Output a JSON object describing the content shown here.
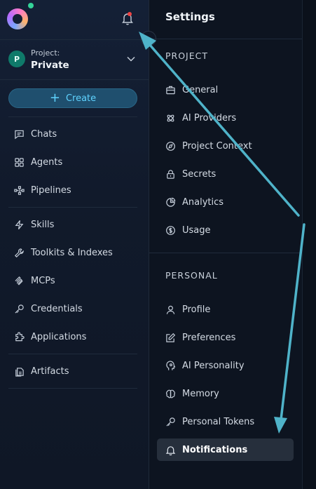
{
  "sidebar": {
    "project": {
      "label": "Project:",
      "name": "Private",
      "avatar_letter": "P"
    },
    "create_label": "Create",
    "items": [
      {
        "label": "Chats",
        "icon": "chat-icon"
      },
      {
        "label": "Agents",
        "icon": "grid-icon"
      },
      {
        "label": "Pipelines",
        "icon": "pipeline-icon"
      },
      {
        "label": "Skills",
        "icon": "lightning-icon"
      },
      {
        "label": "Toolkits & Indexes",
        "icon": "wrench-icon"
      },
      {
        "label": "MCPs",
        "icon": "mcp-icon"
      },
      {
        "label": "Credentials",
        "icon": "key-icon"
      },
      {
        "label": "Applications",
        "icon": "puzzle-icon"
      },
      {
        "label": "Artifacts",
        "icon": "files-icon"
      }
    ]
  },
  "settings": {
    "title": "Settings",
    "sections": [
      {
        "heading": "PROJECT",
        "items": [
          {
            "label": "General",
            "icon": "briefcase-icon"
          },
          {
            "label": "AI Providers",
            "icon": "providers-icon"
          },
          {
            "label": "Project Context",
            "icon": "compass-icon"
          },
          {
            "label": "Secrets",
            "icon": "lock-icon"
          },
          {
            "label": "Analytics",
            "icon": "analytics-icon"
          },
          {
            "label": "Usage",
            "icon": "dollar-icon"
          }
        ]
      },
      {
        "heading": "PERSONAL",
        "items": [
          {
            "label": "Profile",
            "icon": "user-icon"
          },
          {
            "label": "Preferences",
            "icon": "edit-icon"
          },
          {
            "label": "AI Personality",
            "icon": "ai-head-icon"
          },
          {
            "label": "Memory",
            "icon": "brain-icon"
          },
          {
            "label": "Personal Tokens",
            "icon": "key-icon"
          },
          {
            "label": "Notifications",
            "icon": "bell-icon",
            "active": true
          }
        ]
      }
    ]
  },
  "colors": {
    "accent": "#5fd3ff",
    "annotation_arrow": "#4fb3c9",
    "notification_dot": "#ef4444",
    "online_dot": "#34d399"
  }
}
